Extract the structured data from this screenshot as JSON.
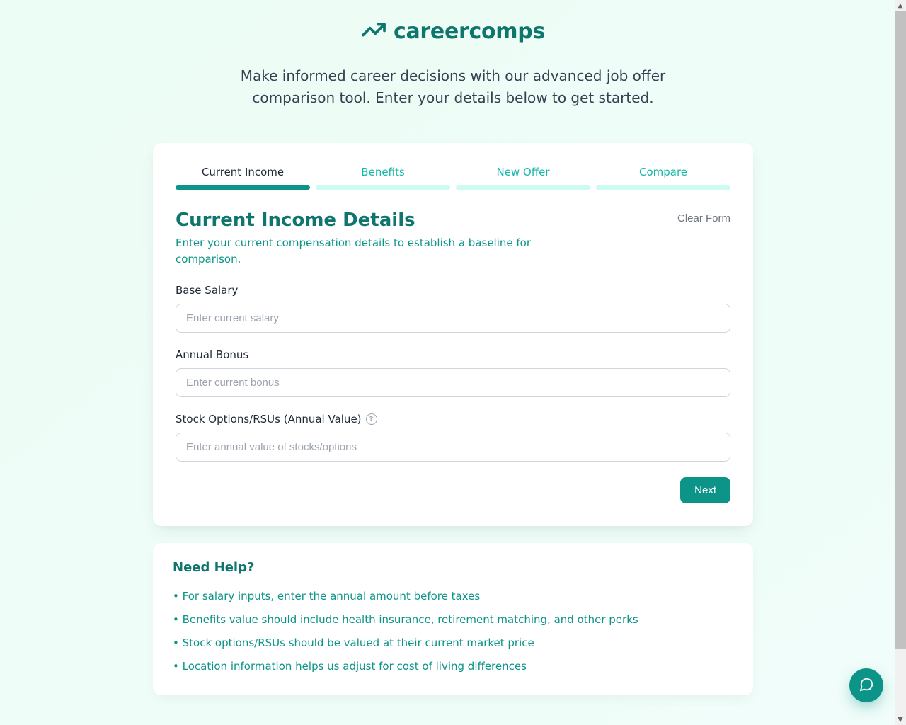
{
  "brand": {
    "name": "careercomps"
  },
  "intro": "Make informed career decisions with our advanced job offer comparison tool. Enter your details below to get started.",
  "steps": [
    {
      "label": "Current Income",
      "active": true
    },
    {
      "label": "Benefits",
      "active": false
    },
    {
      "label": "New Offer",
      "active": false
    },
    {
      "label": "Compare",
      "active": false
    }
  ],
  "section": {
    "title": "Current Income Details",
    "clear": "Clear Form",
    "desc": "Enter your current compensation details to establish a baseline for comparison."
  },
  "fields": {
    "salary": {
      "label": "Base Salary",
      "placeholder": "Enter current salary",
      "value": ""
    },
    "bonus": {
      "label": "Annual Bonus",
      "placeholder": "Enter current bonus",
      "value": ""
    },
    "stock": {
      "label": "Stock Options/RSUs (Annual Value)",
      "placeholder": "Enter annual value of stocks/options",
      "value": ""
    }
  },
  "actions": {
    "next": "Next"
  },
  "help": {
    "title": "Need Help?",
    "items": [
      "• For salary inputs, enter the annual amount before taxes",
      "• Benefits value should include health insurance, retirement matching, and other perks",
      "• Stock options/RSUs should be valued at their current market price",
      "• Location information helps us adjust for cost of living differences"
    ]
  }
}
